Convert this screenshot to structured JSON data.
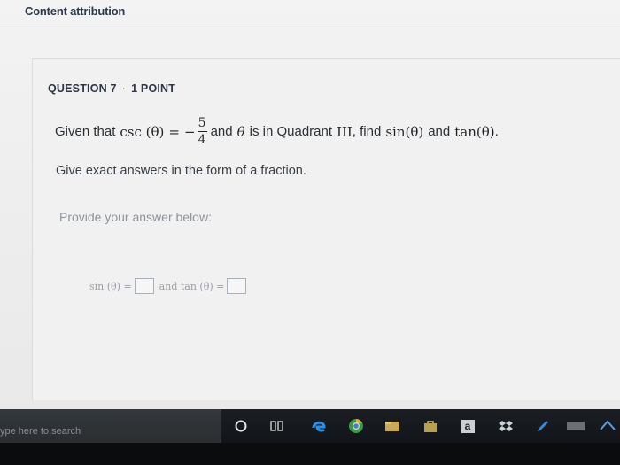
{
  "page": {
    "attribution": "Content attribution"
  },
  "question": {
    "number_label": "QUESTION 7",
    "separator": "·",
    "points_label": "1 POINT",
    "text": {
      "given": "Given that",
      "csc": "csc",
      "theta_arg": "(θ)",
      "equals": "=",
      "minus": "−",
      "numerator": "5",
      "denominator": "4",
      "and": "and",
      "theta": "θ",
      "quadrant_text": "is in Quadrant",
      "quadrant": "III",
      "find": ", find",
      "sin_expr": "sin(θ)",
      "and2": "and",
      "tan_expr": "tan(θ)",
      "period": "."
    },
    "instruction": "Give exact answers in the form of a fraction.",
    "provide": "Provide your answer below:"
  },
  "answer": {
    "sin_label": "sin (θ) =",
    "and_tan_label": "and tan (θ) ="
  },
  "taskbar": {
    "search_placeholder": "ype here to search",
    "icons": [
      "cortana-icon",
      "task-view-icon",
      "edge-icon",
      "chrome-icon",
      "file-explorer-icon",
      "store-icon",
      "amazon-icon",
      "dropbox-icon",
      "pen-icon",
      "hulu-icon",
      "app-icon"
    ],
    "accent": "#0078d7"
  }
}
